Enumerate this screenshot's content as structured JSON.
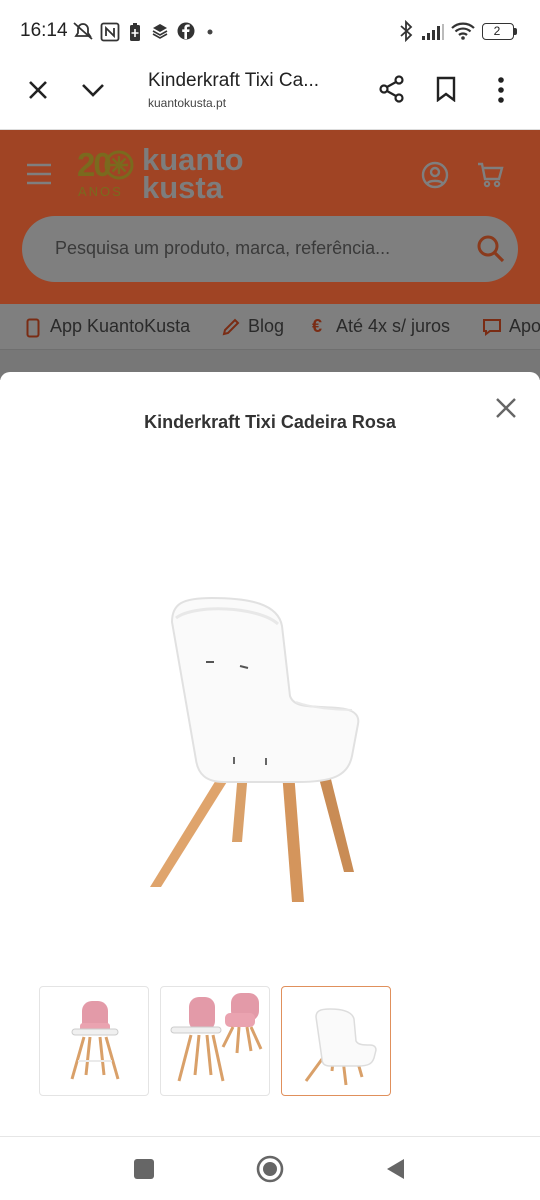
{
  "status_bar": {
    "time": "16:14",
    "battery_level": "2",
    "icons": [
      "no-alarm-icon",
      "nfc-icon",
      "battery-saver-icon",
      "layers-icon",
      "facebook-icon",
      "dot-icon",
      "bluetooth-icon",
      "signal-icon",
      "wifi-icon",
      "battery-icon"
    ]
  },
  "browser": {
    "title": "Kinderkraft Tixi Ca...",
    "domain": "kuantokusta.pt",
    "icons": [
      "close-icon",
      "chevron-down-icon",
      "share-icon",
      "bookmark-icon",
      "more-icon"
    ]
  },
  "site": {
    "logo": {
      "number": "20",
      "anos": "ANOS",
      "line1": "kuanto",
      "line2": "kusta"
    },
    "search_placeholder": "Pesquisa um produto, marca, referência...",
    "quick_links": [
      {
        "label": "App KuantoKusta",
        "icon": "phone-icon"
      },
      {
        "label": "Blog",
        "icon": "pencil-icon"
      },
      {
        "label": "Até 4x s/ juros",
        "icon": "euro-icon"
      },
      {
        "label": "Apo",
        "icon": "chat-icon"
      }
    ],
    "colors": {
      "header": "#a04424",
      "accent": "#e0905c"
    }
  },
  "modal": {
    "title": "Kinderkraft Tixi Cadeira Rosa",
    "thumbnails": [
      {
        "name": "high-chair-pink-front",
        "selected": false
      },
      {
        "name": "high-chair-pink-two-views",
        "selected": false
      },
      {
        "name": "chair-white-back",
        "selected": true
      }
    ]
  },
  "nav_bar": {
    "icons": [
      "recents-icon",
      "home-icon",
      "back-icon"
    ]
  }
}
